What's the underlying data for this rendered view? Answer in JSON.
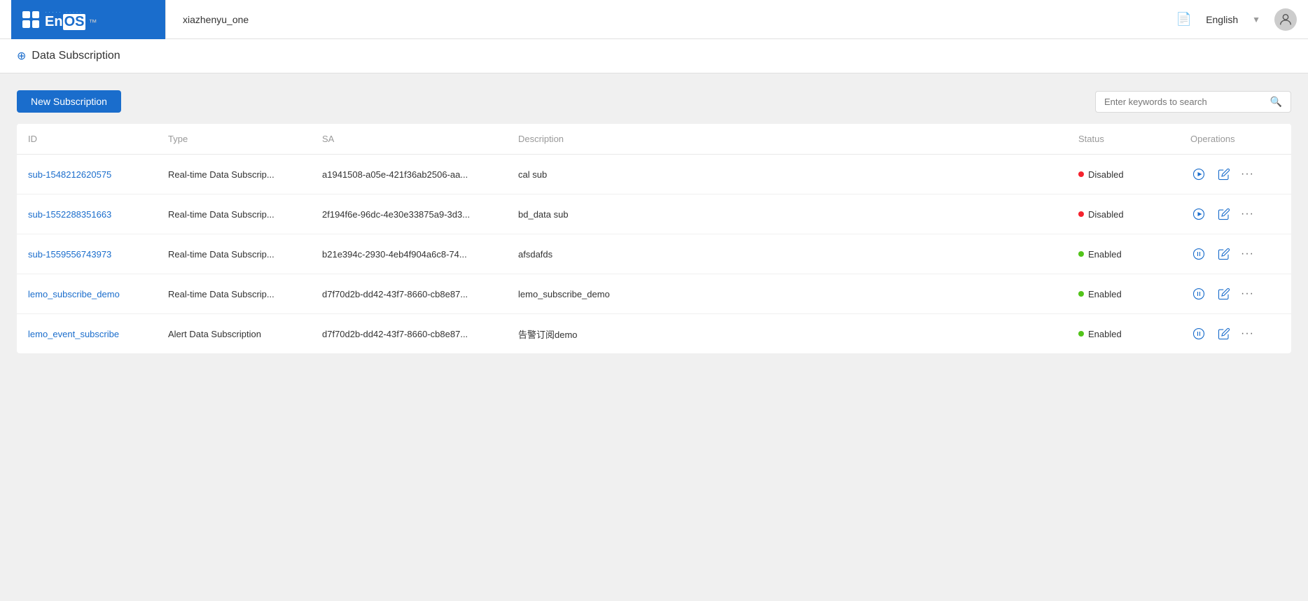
{
  "topbar": {
    "workspace": "xiazhenyu_one",
    "lang": "English",
    "doc_icon": "📄"
  },
  "page": {
    "title": "Data Subscription",
    "icon": "⊕"
  },
  "toolbar": {
    "new_button_label": "New Subscription",
    "search_placeholder": "Enter keywords to search"
  },
  "table": {
    "columns": [
      "ID",
      "Type",
      "SA",
      "Description",
      "Status",
      "Operations"
    ],
    "rows": [
      {
        "id": "sub-1548212620575",
        "type": "Real-time Data Subscrip...",
        "sa": "a1941508-a05e-421f36ab2506-aa...",
        "description": "cal sub",
        "status": "Disabled",
        "status_class": "disabled"
      },
      {
        "id": "sub-1552288351663",
        "type": "Real-time Data Subscrip...",
        "sa": "2f194f6e-96dc-4e30e33875a9-3d3...",
        "description": "bd_data sub",
        "status": "Disabled",
        "status_class": "disabled"
      },
      {
        "id": "sub-1559556743973",
        "type": "Real-time Data Subscrip...",
        "sa": "b21e394c-2930-4eb4f904a6c8-74...",
        "description": "afsdafds",
        "status": "Enabled",
        "status_class": "enabled"
      },
      {
        "id": "lemo_subscribe_demo",
        "type": "Real-time Data Subscrip...",
        "sa": "d7f70d2b-dd42-43f7-8660-cb8e87...",
        "description": "lemo_subscribe_demo",
        "status": "Enabled",
        "status_class": "enabled"
      },
      {
        "id": "lemo_event_subscribe",
        "type": "Alert Data Subscription",
        "sa": "d7f70d2b-dd42-43f7-8660-cb8e87...",
        "description": "告警订阅demo",
        "status": "Enabled",
        "status_class": "enabled"
      }
    ]
  }
}
